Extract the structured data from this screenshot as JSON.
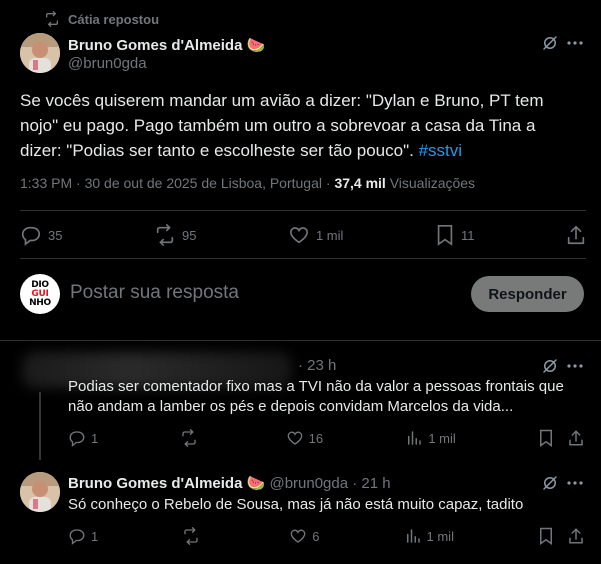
{
  "repost": {
    "label": "Cátia repostou"
  },
  "main_tweet": {
    "author_name": "Bruno Gomes d'Almeida",
    "author_emoji": "🍉",
    "handle": "@brun0gda",
    "text_before_tag": "Se vocês quiserem mandar um avião a dizer: \"Dylan e Bruno, PT tem nojo\" eu pago. Pago também um outro a sobrevoar a casa da Tina a dizer: \"Podias ser tanto e escolheste ser tão pouco\". ",
    "hashtag": "#sstvi",
    "timestamp": "1:33 PM · 30 de out de 2025 de Lisboa, Portugal ·",
    "views_count": "37,4 mil",
    "views_label": "Visualizações",
    "replies": "35",
    "reposts": "95",
    "likes": "1 mil",
    "bookmarks": "11"
  },
  "reply_box": {
    "avatar_text_top": "DIO",
    "avatar_text_mid": "GUI",
    "avatar_text_bot": "NHO",
    "placeholder": "Postar sua resposta",
    "button_label": "Responder"
  },
  "comments": [
    {
      "time": "· 23 h",
      "text": "Podias ser comentador fixo mas a TVI não da valor a pessoas frontais que não andam a lamber os pés e depois convidam Marcelos da vida...",
      "replies": "1",
      "reposts": "",
      "likes": "16",
      "views": "1 mil"
    },
    {
      "author_name": "Bruno Gomes d'Almeida",
      "author_emoji": "🍉",
      "handle_time": "@brun0gda · 21 h",
      "text": "Só conheço o Rebelo de Sousa, mas já não está muito capaz, tadito",
      "replies": "1",
      "reposts": "",
      "likes": "6",
      "views": "1 mil"
    }
  ],
  "colors": {
    "accent": "#1d9bf0",
    "muted": "#71767b",
    "text": "#e7e9ea",
    "divider": "#2f3336"
  }
}
